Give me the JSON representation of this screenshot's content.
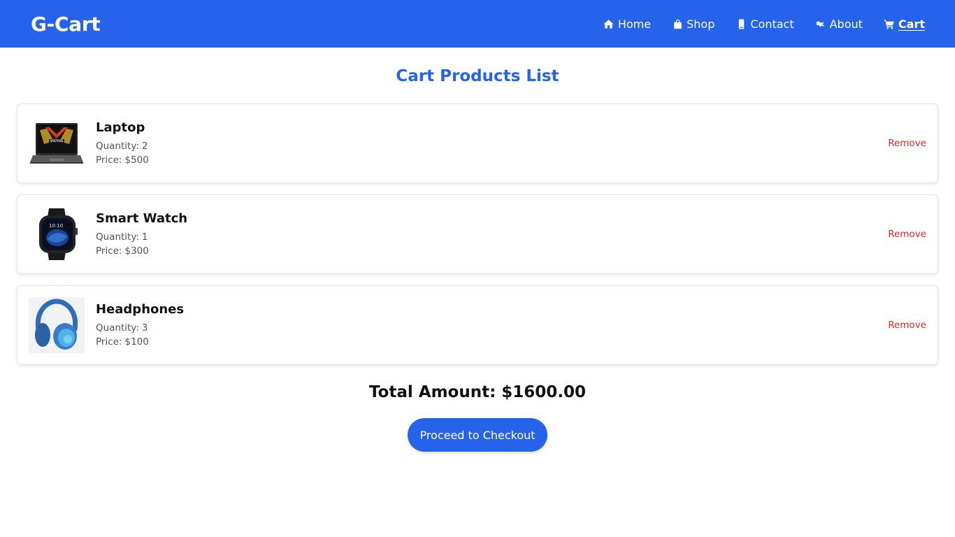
{
  "brand": "G-Cart",
  "nav": [
    {
      "label": "Home",
      "icon": "home-icon"
    },
    {
      "label": "Shop",
      "icon": "shopping-bag-icon"
    },
    {
      "label": "Contact",
      "icon": "phone-icon"
    },
    {
      "label": "About",
      "icon": "hand-icon"
    },
    {
      "label": "Cart",
      "icon": "cart-icon",
      "active": true
    }
  ],
  "page_title": "Cart Products List",
  "cart_items": [
    {
      "name": "Laptop",
      "quantity_label": "Quantity:",
      "quantity": "2",
      "price_label": "Price:",
      "price": "$500",
      "remove_label": "Remove",
      "image": "laptop-image"
    },
    {
      "name": "Smart Watch",
      "quantity_label": "Quantity:",
      "quantity": "1",
      "price_label": "Price:",
      "price": "$300",
      "remove_label": "Remove",
      "image": "smart-watch-image"
    },
    {
      "name": "Headphones",
      "quantity_label": "Quantity:",
      "quantity": "3",
      "price_label": "Price:",
      "price": "$100",
      "remove_label": "Remove",
      "image": "headphones-image"
    }
  ],
  "total": {
    "label": "Total Amount:",
    "value": "$1600.00"
  },
  "checkout_label": "Proceed to Checkout",
  "colors": {
    "primary": "#2563eb",
    "danger": "#dc2626"
  }
}
